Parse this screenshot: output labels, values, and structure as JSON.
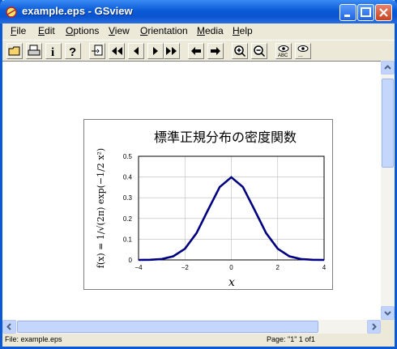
{
  "window": {
    "title": "example.eps - GSview"
  },
  "menu": [
    {
      "label": "File",
      "key": "F",
      "rest": "ile"
    },
    {
      "label": "Edit",
      "key": "E",
      "rest": "dit"
    },
    {
      "label": "Options",
      "key": "O",
      "rest": "ptions"
    },
    {
      "label": "View",
      "key": "V",
      "rest": "iew"
    },
    {
      "label": "Orientation",
      "key": "O",
      "rest": "rientation"
    },
    {
      "label": "Media",
      "key": "M",
      "rest": "edia"
    },
    {
      "label": "Help",
      "key": "H",
      "rest": "elp"
    }
  ],
  "status": {
    "file": "File: example.eps",
    "page": "Page: \"1\"  1 of1"
  },
  "chart_data": {
    "type": "line",
    "title": "標準正規分布の密度関数",
    "xlabel": "x",
    "ylabel": "f(x) = 1/√(2π) exp(−1/2 x²)",
    "xlim": [
      -4,
      4
    ],
    "ylim": [
      0,
      0.5
    ],
    "x_ticks": [
      "−4",
      "−2",
      "0",
      "2",
      "4"
    ],
    "y_ticks": [
      "0",
      "0.1",
      "0.2",
      "0.3",
      "0.4",
      "0.5"
    ],
    "grid": true,
    "line_color": "#000080",
    "series": [
      {
        "x": [
          -4,
          -3.5,
          -3,
          -2.5,
          -2,
          -1.5,
          -1,
          -0.5,
          0,
          0.5,
          1,
          1.5,
          2,
          2.5,
          3,
          3.5,
          4
        ],
        "y": [
          0.0001,
          0.0009,
          0.0044,
          0.0175,
          0.054,
          0.1295,
          0.242,
          0.3521,
          0.3989,
          0.3521,
          0.242,
          0.1295,
          0.054,
          0.0175,
          0.0044,
          0.0009,
          0.0001
        ]
      }
    ]
  }
}
